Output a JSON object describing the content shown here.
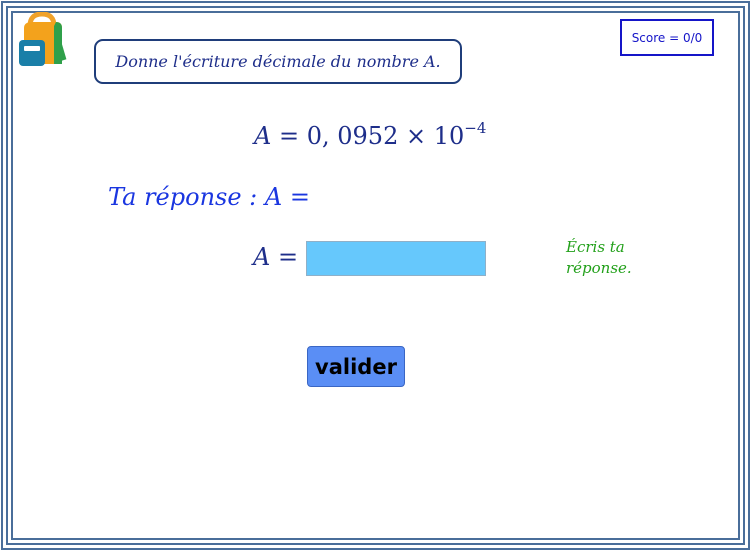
{
  "header": {
    "instruction": "Donne l'écriture décimale du nombre A.",
    "score": "Score = 0/0"
  },
  "expression": {
    "variable": "A",
    "equals": "=",
    "mantissa": "0, 0952",
    "times": "×",
    "base": "10",
    "exponent": "−4"
  },
  "prompt": {
    "text": "Ta réponse : A ="
  },
  "answer": {
    "variable": "A",
    "equals": "=",
    "value": "",
    "placeholder": ""
  },
  "hint": {
    "line1": "Écris ta",
    "line2": "réponse."
  },
  "actions": {
    "validate_label": "valider"
  },
  "icons": {
    "logo": "backpack-icon"
  },
  "colors": {
    "frame": "#4a6e9a",
    "instruction_text": "#1e2e8a",
    "score_border": "#1515c8",
    "prompt_text": "#1a36e0",
    "input_bg": "#66c8fc",
    "hint_text": "#22a01a",
    "button_bg": "#5a8ef5"
  }
}
